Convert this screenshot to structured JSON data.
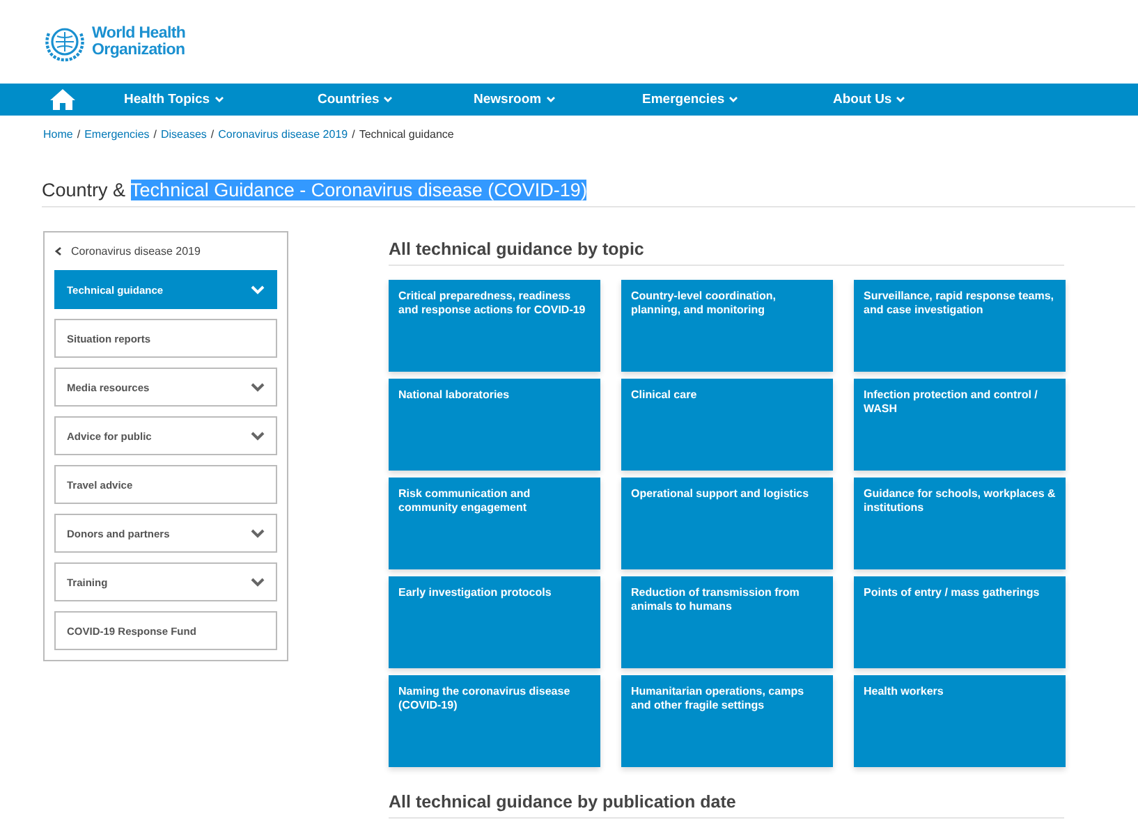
{
  "header": {
    "logo_text": [
      "World Health",
      "Organization"
    ]
  },
  "nav": {
    "items": [
      {
        "label": "Health Topics",
        "has_menu": true
      },
      {
        "label": "Countries",
        "has_menu": true
      },
      {
        "label": "Newsroom",
        "has_menu": true
      },
      {
        "label": "Emergencies",
        "has_menu": true
      },
      {
        "label": "About Us",
        "has_menu": true
      }
    ]
  },
  "breadcrumb": [
    {
      "label": "Home",
      "link": true,
      "separator": "/"
    },
    {
      "label": "Emergencies",
      "link": true,
      "separator": "/"
    },
    {
      "label": "Diseases",
      "link": true,
      "separator": "/"
    },
    {
      "label": "Coronavirus disease 2019",
      "link": true,
      "separator": "/"
    },
    {
      "label": "Technical guidance",
      "link": false
    }
  ],
  "page_title": [
    {
      "text": "Country & ",
      "highlighted": false
    },
    {
      "text": "Technical Guidance - Coronavirus disease (COVID-19)",
      "highlighted": true
    }
  ],
  "sidebar": {
    "back_link": "Coronavirus disease 2019",
    "items": [
      {
        "label": "Technical guidance",
        "selected": true,
        "expandable": true
      },
      {
        "label": "Situation reports",
        "selected": false,
        "expandable": false
      },
      {
        "label": "Media resources",
        "selected": false,
        "expandable": true
      },
      {
        "label": "Advice for public",
        "selected": false,
        "expandable": true
      },
      {
        "label": "Travel advice",
        "selected": false,
        "expandable": false
      },
      {
        "label": "Donors and partners",
        "selected": false,
        "expandable": true
      },
      {
        "label": "Training",
        "selected": false,
        "expandable": true
      },
      {
        "label": "COVID-19 Response Fund",
        "selected": false,
        "expandable": false
      }
    ]
  },
  "topics_section": {
    "heading": "All technical guidance by topic",
    "tiles": [
      "Critical preparedness, readiness and response actions for COVID-19",
      "Country-level coordination, planning, and monitoring",
      "Surveillance, rapid response teams, and case investigation",
      "National laboratories",
      "Clinical care",
      "Infection protection and control / WASH",
      "Risk communication and community engagement",
      "Operational support and logistics",
      "Guidance for schools, workplaces & institutions",
      "Early investigation protocols",
      "Reduction of transmission from animals to humans",
      "Points of entry / mass gatherings",
      "Naming the coronavirus disease (COVID-19)",
      "Humanitarian operations, camps and other fragile settings",
      "Health workers"
    ]
  },
  "date_section": {
    "heading": "All technical guidance by publication date"
  }
}
